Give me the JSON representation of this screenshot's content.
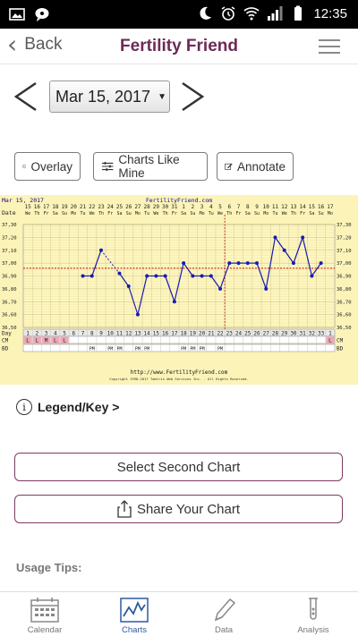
{
  "status_bar": {
    "time": "12:35",
    "left_icons": [
      "image-icon",
      "chat-icon"
    ],
    "right_icons": [
      "do-not-disturb-icon",
      "alarm-icon",
      "wifi-icon",
      "signal-icon",
      "battery-icon"
    ]
  },
  "header": {
    "back_label": "Back",
    "title": "Fertility Friend",
    "menu_icon": "hamburger-menu-icon"
  },
  "date_picker": {
    "value": "Mar 15, 2017",
    "prev_icon": "chevron-left-icon",
    "next_icon": "chevron-right-icon"
  },
  "toolbar": {
    "overlay_label": "Overlay",
    "charts_like_mine_label": "Charts Like Mine",
    "annotate_label": "Annotate"
  },
  "chart": {
    "header_date": "Mar 15, 2017",
    "header_site": "FertilityFriend.com",
    "footer_url": "http://www.FertilityFriend.com",
    "footer_copyright": "Copyright 1998-2017 Tamtris Web Services Inc. - All Rights Reserved.",
    "row_labels": {
      "date": "Date",
      "day": "Day",
      "cm": "CM",
      "bd": "BD"
    }
  },
  "chart_data": {
    "type": "line",
    "title": "FertilityFriend.com",
    "ylim": [
      36.5,
      37.3
    ],
    "y_ticks": [
      "37,30",
      "37,20",
      "37,10",
      "37,00",
      "36,90",
      "36,80",
      "36,70",
      "36,60",
      "36,50"
    ],
    "dates": [
      "15",
      "16",
      "17",
      "18",
      "19",
      "20",
      "21",
      "22",
      "23",
      "24",
      "25",
      "26",
      "27",
      "28",
      "29",
      "30",
      "31",
      "1",
      "2",
      "3",
      "4",
      "5",
      "6",
      "7",
      "8",
      "9",
      "10",
      "11",
      "12",
      "13",
      "14",
      "15",
      "16",
      "17"
    ],
    "weekdays": [
      "We",
      "Th",
      "Fr",
      "Sa",
      "Su",
      "Mo",
      "Tu",
      "We",
      "Th",
      "Fr",
      "Sa",
      "Su",
      "Mo",
      "Tu",
      "We",
      "Th",
      "Fr",
      "Sa",
      "Su",
      "Mo",
      "Tu",
      "We",
      "Th",
      "Fr",
      "Sa",
      "Su",
      "Mo",
      "Tu",
      "We",
      "Th",
      "Fr",
      "Sa",
      "Su",
      "Mo"
    ],
    "cycle_days": [
      "1",
      "2",
      "3",
      "4",
      "5",
      "6",
      "7",
      "8",
      "9",
      "10",
      "11",
      "12",
      "13",
      "14",
      "15",
      "16",
      "17",
      "18",
      "19",
      "20",
      "21",
      "22",
      "23",
      "24",
      "25",
      "26",
      "27",
      "28",
      "29",
      "30",
      "31",
      "32",
      "33",
      "1"
    ],
    "temperatures": [
      null,
      null,
      null,
      null,
      null,
      null,
      36.9,
      36.9,
      37.1,
      null,
      36.92,
      36.82,
      36.6,
      36.9,
      36.9,
      36.9,
      36.7,
      37.0,
      36.9,
      36.9,
      36.9,
      36.8,
      37.0,
      37.0,
      37.0,
      37.0,
      36.8,
      37.2,
      37.1,
      37.0,
      37.2,
      36.9,
      37.0,
      null
    ],
    "coverline": 36.96,
    "ovulation_day_index": 21,
    "cm": [
      "L",
      "L",
      "M",
      "L",
      "L",
      "",
      "",
      "",
      "",
      "",
      "",
      "",
      "",
      "",
      "",
      "",
      "",
      "",
      "",
      "",
      "",
      "",
      "",
      "",
      "",
      "",
      "",
      "",
      "",
      "",
      "",
      "",
      "",
      "L"
    ],
    "bd": [
      "",
      "",
      "",
      "",
      "",
      "",
      "",
      "PM",
      "",
      "PM",
      "PM",
      "",
      "PM",
      "PM",
      "",
      "",
      "",
      "PM",
      "PM",
      "PM",
      "",
      "PM",
      "",
      "",
      "",
      "",
      "",
      "",
      "",
      "",
      "",
      "",
      "",
      ""
    ],
    "grid": true
  },
  "legend": {
    "label": "Legend/Key >"
  },
  "buttons": {
    "select_second_chart": "Select Second Chart",
    "share_chart": "Share Your Chart"
  },
  "tips": {
    "label": "Usage Tips:"
  },
  "tabbar": {
    "tabs": [
      {
        "label": "Calendar",
        "icon": "calendar-icon"
      },
      {
        "label": "Charts",
        "icon": "chart-icon"
      },
      {
        "label": "Data",
        "icon": "pencil-icon"
      },
      {
        "label": "Analysis",
        "icon": "test-tube-icon"
      }
    ],
    "active_index": 1,
    "accent_color": "#2c5aa0"
  },
  "colors": {
    "brand": "#6d2a55",
    "chart_bg": "#fbf3b8",
    "chart_line": "#1a1ab0",
    "coverline": "#c0392b",
    "cm_fill": "#f2a6b4"
  }
}
